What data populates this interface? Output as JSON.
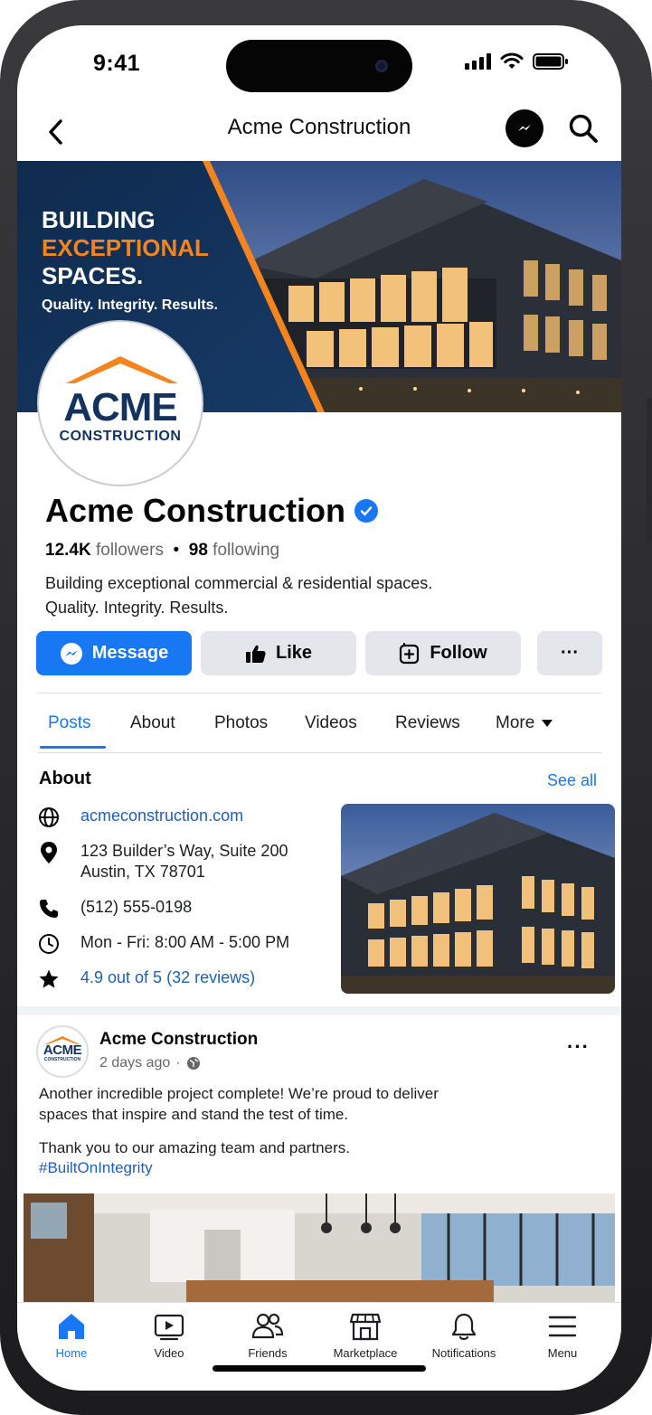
{
  "status_bar": {
    "time": "9:41"
  },
  "nav": {
    "title": "Acme Construction"
  },
  "cover": {
    "line1": "BUILDING",
    "line2": "EXCEPTIONAL",
    "line3": "SPACES.",
    "tagline": "Quality. Integrity. Results."
  },
  "logo": {
    "word": "ACME",
    "sub": "CONSTRUCTION"
  },
  "page": {
    "name": "Acme Construction",
    "followers_count": "12.4K",
    "followers_label": "followers",
    "separator": "•",
    "following_count": "98",
    "following_label": "following",
    "bio_line1": "Building exceptional commercial & residential spaces.",
    "bio_line2": "Quality. Integrity. Results."
  },
  "actions": {
    "message": "Message",
    "like": "Like",
    "follow": "Follow",
    "more": "···"
  },
  "tabs": [
    {
      "label": "Posts",
      "active": true
    },
    {
      "label": "About"
    },
    {
      "label": "Photos"
    },
    {
      "label": "Videos"
    },
    {
      "label": "Reviews"
    },
    {
      "label": "More"
    }
  ],
  "about": {
    "title": "About",
    "see_all": "See all",
    "website": "acmeconstruction.com",
    "address_line1": "123 Builder’s Way, Suite 200",
    "address_line2": "Austin, TX 78701",
    "phone": "(512) 555-0198",
    "hours": "Mon - Fri: 8:00 AM - 5:00 PM",
    "rating": "4.9 out of 5 (32 reviews)"
  },
  "post": {
    "author": "Acme Construction",
    "time": "2 days ago",
    "separator": "·",
    "more": "···",
    "text_line1": "Another incredible project complete! We’re proud to deliver",
    "text_line2": "spaces that inspire and stand the test of time.",
    "text_line3": "Thank you to our amazing team and partners.",
    "hashtag": "#BuiltOnIntegrity",
    "avatar_word": "ACME",
    "avatar_sub": "CONSTRUCTION"
  },
  "bottom_nav": [
    {
      "label": "Home",
      "icon": "home-icon",
      "active": true
    },
    {
      "label": "Video",
      "icon": "video-icon"
    },
    {
      "label": "Friends",
      "icon": "friends-icon"
    },
    {
      "label": "Marketplace",
      "icon": "marketplace-icon"
    },
    {
      "label": "Notifications",
      "icon": "bell-icon"
    },
    {
      "label": "Menu",
      "icon": "menu-icon"
    }
  ],
  "colors": {
    "accent": "#1877f2",
    "brand_navy": "#13335e",
    "brand_orange": "#f5841f",
    "button_gray": "#e4e6eb",
    "link": "#1f5fb4"
  }
}
